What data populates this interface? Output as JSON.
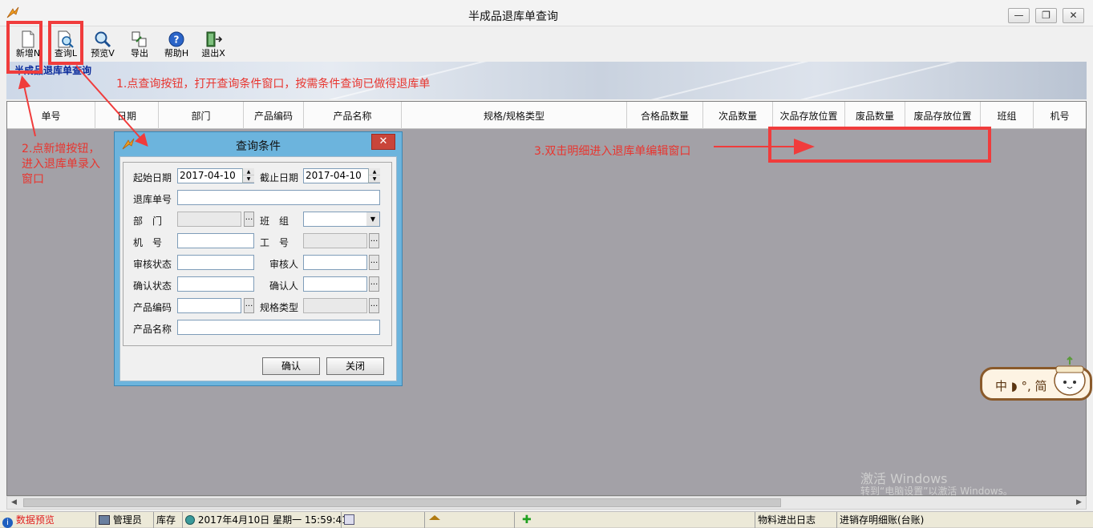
{
  "window": {
    "title": "半成品退库单查询"
  },
  "toolbar": {
    "buttons": [
      {
        "label": "新增N"
      },
      {
        "label": "查询L"
      },
      {
        "label": "预览V"
      },
      {
        "label": "导出"
      },
      {
        "label": "帮助H"
      },
      {
        "label": "退出X"
      }
    ]
  },
  "banner": {
    "title": "半成品退库单查询"
  },
  "grid": {
    "columns": [
      "单号",
      "日期",
      "部门",
      "产品编码",
      "产品名称",
      "规格/规格类型",
      "合格品数量",
      "次品数量",
      "次品存放位置",
      "废品数量",
      "废品存放位置",
      "班组",
      "机号"
    ]
  },
  "dialog": {
    "title": "查询条件",
    "fields": {
      "start_date_label": "起始日期",
      "start_date_value": "2017-04-10",
      "end_date_label": "截止日期",
      "end_date_value": "2017-04-10",
      "return_no_label": "退库单号",
      "dept_label": "部　门",
      "team_label": "班　组",
      "machine_label": "机　号",
      "worker_label": "工　号",
      "audit_status_label": "审核状态",
      "auditor_label": "审核人",
      "confirm_status_label": "确认状态",
      "confirmer_label": "确认人",
      "product_code_label": "产品编码",
      "spec_type_label": "规格类型",
      "product_name_label": "产品名称"
    },
    "confirm_label": "确认",
    "close_label": "关闭",
    "ellipsis": "..."
  },
  "annotations": {
    "a1": "1.点查询按钮，打开查询条件窗口，按需条件查询已做得退库单",
    "a2_line1": "2.点新增按钮，",
    "a2_line2": "进入退库单录入",
    "a2_line3": "窗口",
    "a3": "3.双击明细进入退库单编辑窗口"
  },
  "ime": {
    "text": "中 ◗ °, 简"
  },
  "watermark": {
    "line1": "激活 Windows",
    "line2": "转到“电脑设置”以激活 Windows。"
  },
  "statusbar": {
    "preview": "数据预览",
    "user": "管理员",
    "module": "库存",
    "datetime": "2017年4月10日 星期一 15:59:41",
    "log": "物料进出日志",
    "ledger": "进销存明细账(台账)"
  },
  "colors": {
    "annotation_red": "#f03c3c",
    "dialog_frame": "#6cb4dd",
    "grid_bg": "#a3a1a7"
  }
}
